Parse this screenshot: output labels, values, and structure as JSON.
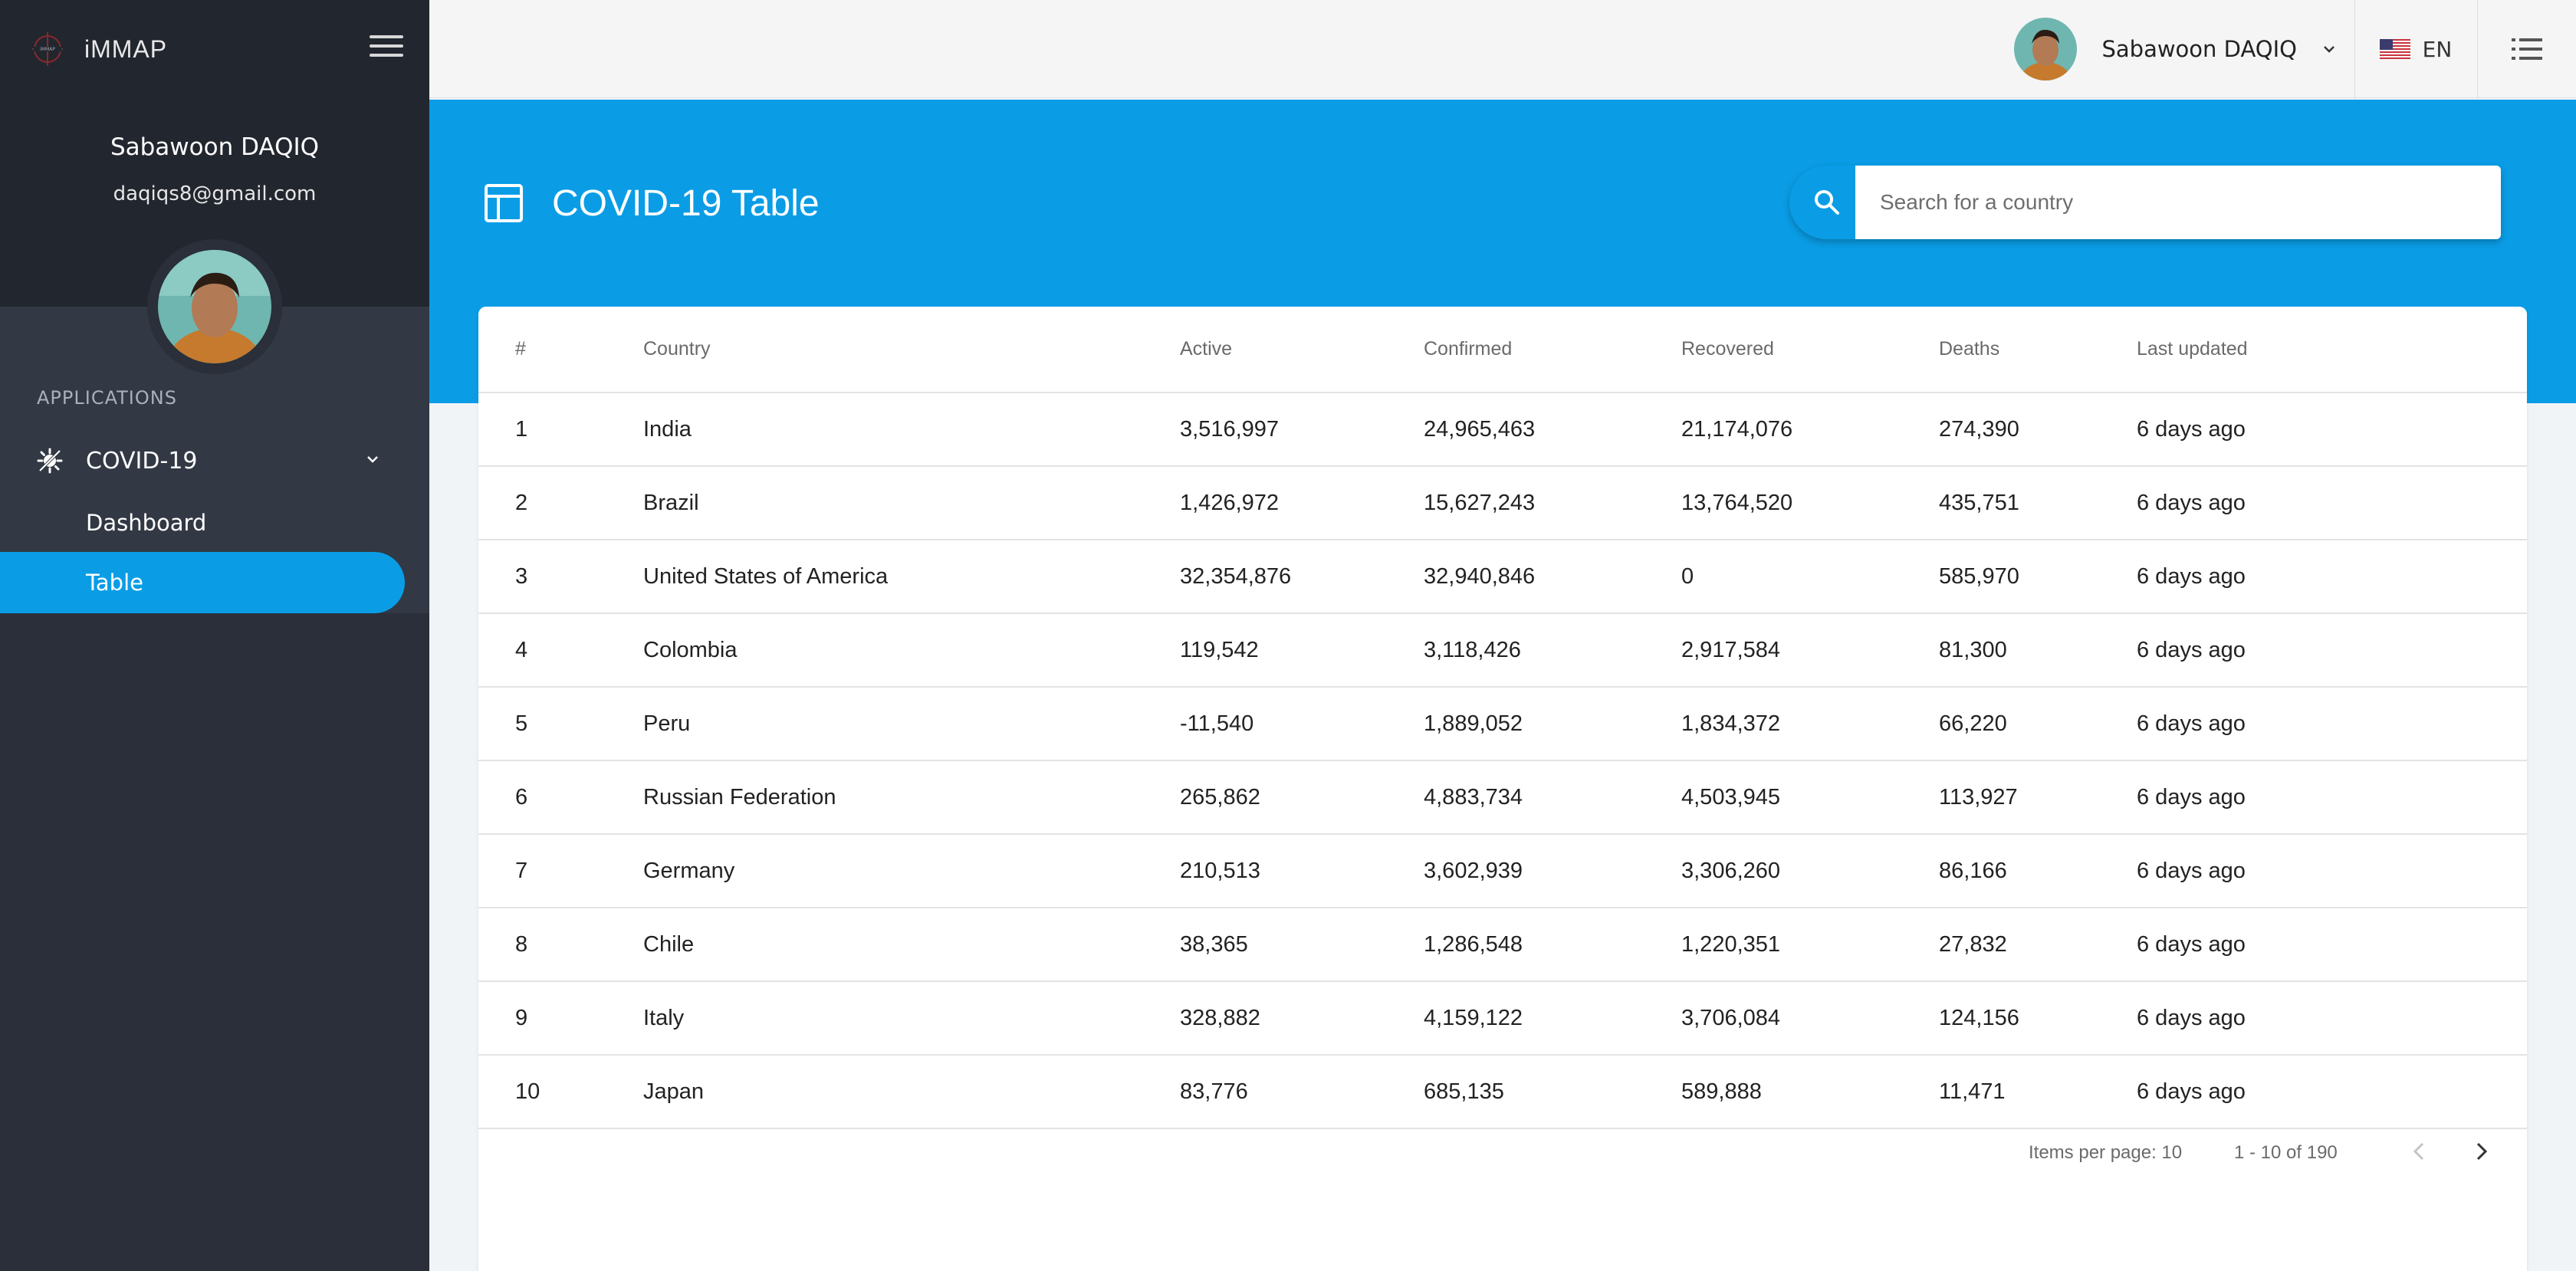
{
  "app": {
    "name": "iMMAP"
  },
  "sidebar": {
    "user_name": "Sabawoon DAQIQ",
    "user_email": "daqiqs8@gmail.com",
    "section_label": "APPLICATIONS",
    "group_label": "COVID-19",
    "items": [
      {
        "label": "Dashboard",
        "active": false
      },
      {
        "label": "Table",
        "active": true
      }
    ]
  },
  "topbar": {
    "user_name": "Sabawoon DAQIQ",
    "language": "EN"
  },
  "header": {
    "title": "COVID-19 Table",
    "search_placeholder": "Search for a country"
  },
  "table": {
    "columns": [
      "#",
      "Country",
      "Active",
      "Confirmed",
      "Recovered",
      "Deaths",
      "Last updated"
    ],
    "rows": [
      [
        "1",
        "India",
        "3,516,997",
        "24,965,463",
        "21,174,076",
        "274,390",
        "6 days ago"
      ],
      [
        "2",
        "Brazil",
        "1,426,972",
        "15,627,243",
        "13,764,520",
        "435,751",
        "6 days ago"
      ],
      [
        "3",
        "United States of America",
        "32,354,876",
        "32,940,846",
        "0",
        "585,970",
        "6 days ago"
      ],
      [
        "4",
        "Colombia",
        "119,542",
        "3,118,426",
        "2,917,584",
        "81,300",
        "6 days ago"
      ],
      [
        "5",
        "Peru",
        "-11,540",
        "1,889,052",
        "1,834,372",
        "66,220",
        "6 days ago"
      ],
      [
        "6",
        "Russian Federation",
        "265,862",
        "4,883,734",
        "4,503,945",
        "113,927",
        "6 days ago"
      ],
      [
        "7",
        "Germany",
        "210,513",
        "3,602,939",
        "3,306,260",
        "86,166",
        "6 days ago"
      ],
      [
        "8",
        "Chile",
        "38,365",
        "1,286,548",
        "1,220,351",
        "27,832",
        "6 days ago"
      ],
      [
        "9",
        "Italy",
        "328,882",
        "4,159,122",
        "3,706,084",
        "124,156",
        "6 days ago"
      ],
      [
        "10",
        "Japan",
        "83,776",
        "685,135",
        "589,888",
        "11,471",
        "6 days ago"
      ]
    ]
  },
  "paginator": {
    "items_per_page": "Items per page: 10",
    "range": "1 - 10 of 190"
  },
  "colors": {
    "accent": "#0a9de6",
    "sidebar_bg": "#2a2f3a",
    "sidebar_top_bg": "#22262f"
  }
}
